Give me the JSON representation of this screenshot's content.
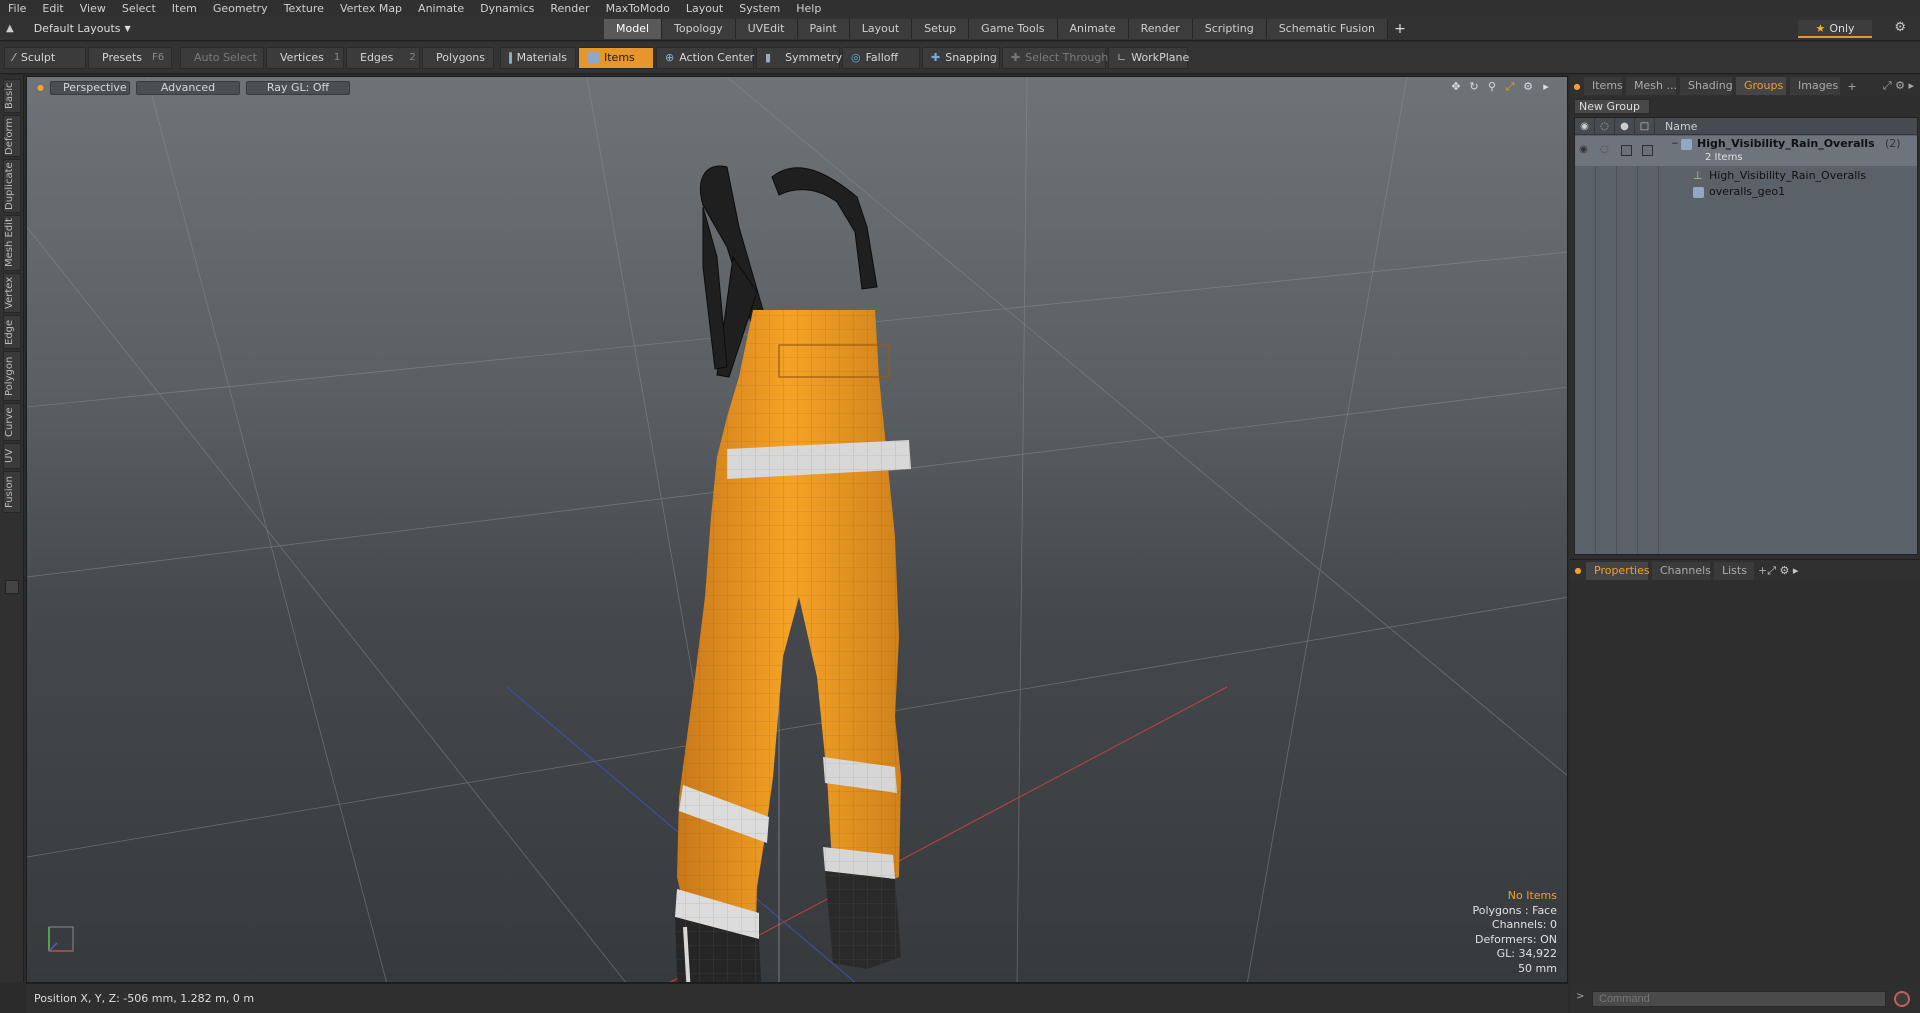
{
  "menu": [
    "File",
    "Edit",
    "View",
    "Select",
    "Item",
    "Geometry",
    "Texture",
    "Vertex Map",
    "Animate",
    "Dynamics",
    "Render",
    "MaxToModo",
    "Layout",
    "System",
    "Help"
  ],
  "layouts": {
    "label": "Default Layouts"
  },
  "tabs": [
    {
      "label": "Model",
      "active": true
    },
    {
      "label": "Topology"
    },
    {
      "label": "UVEdit"
    },
    {
      "label": "Paint"
    },
    {
      "label": "Layout"
    },
    {
      "label": "Setup"
    },
    {
      "label": "Game Tools"
    },
    {
      "label": "Animate"
    },
    {
      "label": "Render"
    },
    {
      "label": "Scripting"
    },
    {
      "label": "Schematic Fusion"
    }
  ],
  "only_label": "Only",
  "toolbar": {
    "sculpt": "Sculpt",
    "presets": "Presets",
    "presets_key": "F6",
    "auto_select": "Auto Select",
    "vertices": "Vertices",
    "vertices_num": "1",
    "edges": "Edges",
    "edges_num": "2",
    "polygons": "Polygons",
    "materials": "Materials",
    "items": "Items",
    "action_center": "Action Center",
    "symmetry": "Symmetry",
    "falloff": "Falloff",
    "snapping": "Snapping",
    "select_through": "Select Through",
    "workplane": "WorkPlane"
  },
  "left_tabs": [
    "Basic",
    "Deform",
    "Duplicate",
    "Mesh Edit",
    "Vertex",
    "Edge",
    "Polygon",
    "Curve",
    "UV",
    "Fusion"
  ],
  "viewport": {
    "view": "Perspective",
    "mode": "Advanced",
    "raygl": "Ray GL: Off",
    "info": {
      "selection": "No Items",
      "polygons": "Polygons : Face",
      "channels": "Channels: 0",
      "deformers": "Deformers: ON",
      "gl": "GL: 34,922",
      "scale": "50 mm"
    }
  },
  "status": {
    "position": "Position X, Y, Z:  -506 mm, 1.282 m, 0 m"
  },
  "right_tabs": [
    {
      "label": "Items"
    },
    {
      "label": "Mesh ..."
    },
    {
      "label": "Shading"
    },
    {
      "label": "Groups",
      "active": true
    },
    {
      "label": "Images"
    }
  ],
  "groups": {
    "new_group": "New Group",
    "col_name": "Name",
    "root_name": "High_Visibility_Rain_Overalls",
    "root_count": "(2)",
    "root_sub": "2 Items",
    "child1": "High_Visibility_Rain_Overalls",
    "child2": "overalls_geo1"
  },
  "props_tabs": [
    {
      "label": "Properties",
      "active": true
    },
    {
      "label": "Channels"
    },
    {
      "label": "Lists"
    }
  ],
  "command_placeholder": "Command",
  "colors": {
    "accent": "#e7962b",
    "garment": "#f0a022",
    "reflective": "#d8d8d8"
  }
}
